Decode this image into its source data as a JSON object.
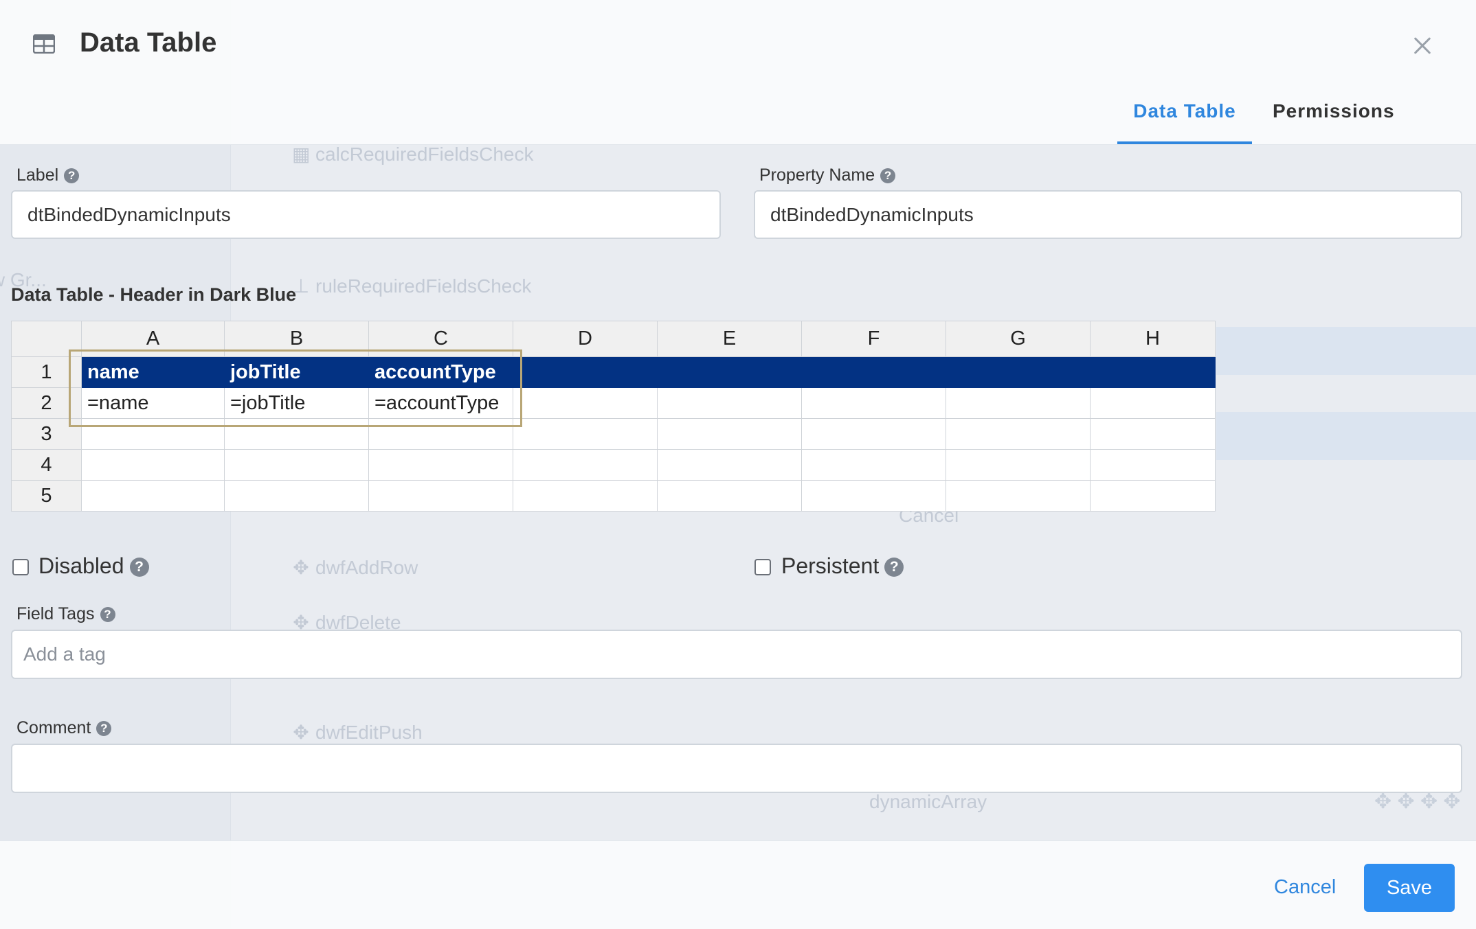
{
  "background": {
    "items": [
      {
        "text": "calcRequiredFieldsCheck",
        "icon": "calculator-icon"
      },
      {
        "text": "ruleRequiredFieldsCheck",
        "icon": "sitemap-icon"
      },
      {
        "text": "dwfAddRow",
        "icon": "move-icon"
      },
      {
        "text": "dwfDelete",
        "icon": "move-icon"
      },
      {
        "text": "dwfEditPush",
        "icon": "move-icon"
      }
    ],
    "left_items": [
      "amic View Gr...",
      "dnamic View Grid"
    ],
    "misc": [
      "Cancel",
      "dynamicArray"
    ]
  },
  "modal": {
    "title": "Data Table",
    "title_icon": "table-icon",
    "tabs": [
      {
        "label": "Data Table",
        "active": true
      },
      {
        "label": "Permissions",
        "active": false
      }
    ],
    "label_field": {
      "label": "Label",
      "value": "dtBindedDynamicInputs"
    },
    "property_name_field": {
      "label": "Property Name",
      "value": "dtBindedDynamicInputs"
    },
    "grid_title": "Data Table - Header in Dark Blue",
    "grid": {
      "columns": [
        "A",
        "B",
        "C",
        "D",
        "E",
        "F",
        "G",
        "H"
      ],
      "rows": [
        {
          "num": "1",
          "cells": [
            "name",
            "jobTitle",
            "accountType",
            "",
            "",
            "",
            "",
            ""
          ]
        },
        {
          "num": "2",
          "cells": [
            "=name",
            "=jobTitle",
            "=accountType",
            "",
            "",
            "",
            "",
            ""
          ]
        },
        {
          "num": "3",
          "cells": [
            "",
            "",
            "",
            "",
            "",
            "",
            "",
            ""
          ]
        },
        {
          "num": "4",
          "cells": [
            "",
            "",
            "",
            "",
            "",
            "",
            "",
            ""
          ]
        },
        {
          "num": "5",
          "cells": [
            "",
            "",
            "",
            "",
            "",
            "",
            "",
            ""
          ]
        }
      ],
      "header_color": "#033283"
    },
    "disabled": {
      "label": "Disabled",
      "checked": false
    },
    "persistent": {
      "label": "Persistent",
      "checked": false
    },
    "field_tags": {
      "label": "Field Tags",
      "placeholder": "Add a tag",
      "value": ""
    },
    "comment": {
      "label": "Comment",
      "value": ""
    },
    "footer": {
      "cancel": "Cancel",
      "save": "Save"
    },
    "accent_color": "#2f86de"
  }
}
